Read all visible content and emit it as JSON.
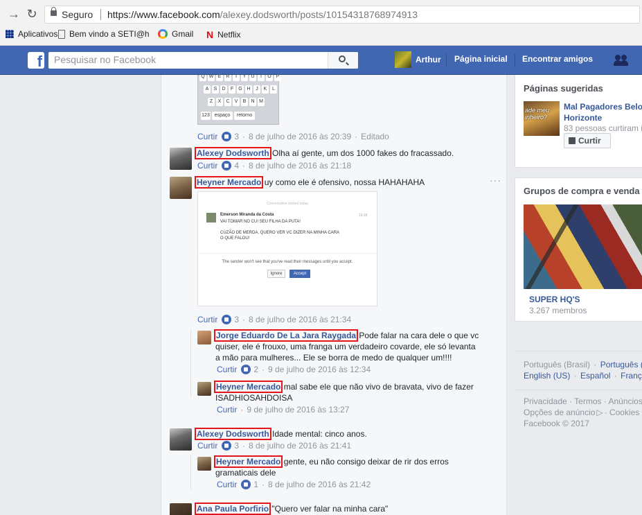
{
  "browser": {
    "secure_label": "Seguro",
    "url_host": "https://www.facebook.com",
    "url_path": "/alexey.dodsworth/posts/10154318768974913",
    "bookmarks": [
      "Aplicativos",
      "Bem vindo a SETI@h",
      "Gmail",
      "Netflix"
    ]
  },
  "fb": {
    "logo": "f",
    "search_placeholder": "Pesquisar no Facebook",
    "user": "Arthur",
    "nav_home": "Página inicial",
    "nav_find": "Encontrar amigos",
    "brand_color": "#4267b2"
  },
  "keyboard": {
    "row1": [
      "Q",
      "W",
      "E",
      "R",
      "T",
      "Y",
      "U",
      "I",
      "O",
      "P"
    ],
    "row2": [
      "A",
      "S",
      "D",
      "F",
      "G",
      "H",
      "J",
      "K",
      "L"
    ],
    "row3": [
      "Z",
      "X",
      "C",
      "V",
      "B",
      "N",
      "M"
    ],
    "row4": [
      "123",
      "espaço",
      "retorno"
    ]
  },
  "comments": {
    "c0": {
      "like": "Curtir",
      "count": "3",
      "time": "8 de julho de 2016 às 20:39",
      "edited": "Editado"
    },
    "c1": {
      "name": "Alexey Dodsworth",
      "text": "Olha aí gente, um dos 1000 fakes do fracassado.",
      "like": "Curtir",
      "count": "4",
      "time": "8 de julho de 2016 às 21:18"
    },
    "c2": {
      "name": "Heyner Mercado",
      "text": "uy como ele é ofensivo, nossa HAHAHAHA",
      "like": "Curtir",
      "count": "3",
      "time": "8 de julho de 2016 às 21:34",
      "more": "···"
    },
    "c2r1": {
      "name": "Jorge Eduardo De La Jara Raygada",
      "text1": "Pode falar na cara dele o que vc",
      "text2": "quiser, ele é frouxo, uma franga um verdadeiro covarde, ele só levanta",
      "text3": "a mão para mulheres... Ele se borra de medo de qualquer um!!!!",
      "like": "Curtir",
      "count": "2",
      "time": "9 de julho de 2016 às 12:34"
    },
    "c2r2": {
      "name": "Heyner Mercado",
      "text1": "mal sabe ele que não vivo de bravata, vivo de fazer",
      "text2": "ISADHIOSAHDOISA",
      "like": "Curtir",
      "time": "9 de julho de 2016 às 13:27"
    },
    "c3": {
      "name": "Alexey Dodsworth",
      "text": "Idade mental: cinco anos.",
      "like": "Curtir",
      "count": "3",
      "time": "8 de julho de 2016 às 21:41"
    },
    "c3r1": {
      "name": "Heyner Mercado",
      "text1": "gente, eu não consigo deixar de rir dos erros",
      "text2": "gramaticais dele",
      "like": "Curtir",
      "count": "1",
      "time": "8 de julho de 2016 às 21:42"
    },
    "c4": {
      "name": "Ana Paula Porfirio",
      "text": "\"Quero ver falar na minha cara\""
    }
  },
  "screenshot": {
    "header": "Conversation started today",
    "from": "Emerson Miranda da Costa",
    "time": "19:18",
    "line1": "VAI TOMAR NO CU! SEU FILHA DA PUTA!",
    "line2": "CÚZÃO DE MERDA, QUERO VER VC DIZER NA MINHA CARA",
    "line3": "O QUE FALOU!",
    "note": "The sender won't see that you've read their messages until you accept.",
    "ignore": "Ignore",
    "accept": "Accept"
  },
  "sidebar": {
    "pages_title": "Páginas sugeridas",
    "page_thumb_text": "ade meu inheiro?",
    "page_name1": "Mal Pagadores Belo",
    "page_name2": "Horizonte",
    "page_sub": "83 pessoas curtiram i",
    "page_btn": "Curtir",
    "groups_title": "Grupos de compra e venda",
    "group_name": "SUPER HQ'S",
    "group_sub": "3.267 membros",
    "lang_current": "Português (Brasil)",
    "lang_1": "Português (",
    "lang_2": "English (US)",
    "lang_3": "Español",
    "lang_4": "Françai",
    "foot1": "Privacidade · Termos · Anúncios",
    "foot2": "Opções de anúncio",
    "foot2b": "· Cookies",
    "foot3": "Facebook © 2017"
  }
}
